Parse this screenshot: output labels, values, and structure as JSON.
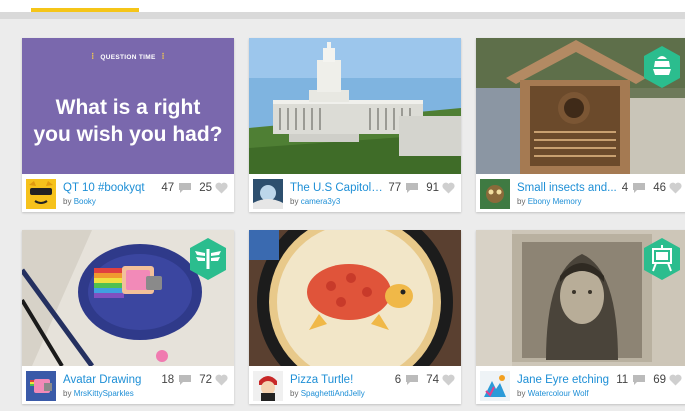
{
  "accent_color": "#f5c518",
  "link_color": "#1e8fd6",
  "cards": [
    {
      "title": "QT 10 #bookyqt",
      "by": "by",
      "author": "Booky",
      "comments": "47",
      "likes": "25",
      "thumb_heading": "QUESTION TIME",
      "thumb_text_line1": "What is a right",
      "thumb_text_line2": "you wish you had?"
    },
    {
      "title": "The U.S Capitol B...",
      "by": "by",
      "author": "camera3y3",
      "comments": "77",
      "likes": "91"
    },
    {
      "title": "Small insects and...",
      "by": "by",
      "author": "Ebony Memory",
      "comments": "4",
      "likes": "46",
      "badge_icon": "beehive-icon"
    },
    {
      "title": "Avatar Drawing",
      "by": "by",
      "author": "MrsKittySparkles",
      "comments": "18",
      "likes": "72",
      "badge_icon": "wings-icon"
    },
    {
      "title": "Pizza Turtle!",
      "by": "by",
      "author": "SpaghettiAndJelly",
      "comments": "6",
      "likes": "74"
    },
    {
      "title": "Jane Eyre etching",
      "by": "by",
      "author": "Watercolour Wolf",
      "comments": "11",
      "likes": "69",
      "badge_icon": "easel-icon"
    }
  ]
}
